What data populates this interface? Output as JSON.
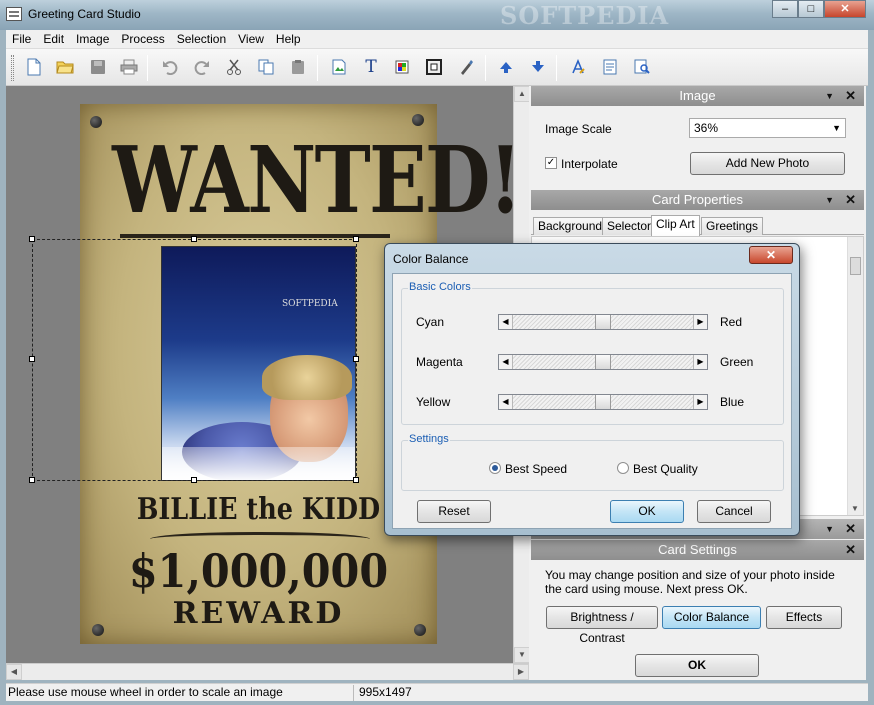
{
  "window": {
    "title": "Greeting Card Studio",
    "watermark": "SOFTPEDIA",
    "minimize": "–",
    "maximize": "□",
    "close": "✕"
  },
  "menu": [
    "File",
    "Edit",
    "Image",
    "Process",
    "Selection",
    "View",
    "Help"
  ],
  "toolbar": {
    "icons": [
      "new-file-icon",
      "open-folder-icon",
      "save-icon",
      "print-icon",
      "undo-icon",
      "redo-icon",
      "cut-icon",
      "copy-icon",
      "paste-icon",
      "insert-image-icon",
      "text-icon",
      "effects-icon",
      "frame-icon",
      "brush-icon",
      "move-up-icon",
      "move-down-icon",
      "font-icon",
      "document-icon",
      "find-icon"
    ],
    "text_glyph": "T"
  },
  "poster": {
    "headline": "WANTED!",
    "name": "BILLIE the KIDD",
    "amount": "$1,000,000",
    "reward": "REWARD",
    "photo_watermark": "SOFTPEDIA"
  },
  "image_panel": {
    "title": "Image",
    "scale_label": "Image Scale",
    "scale_value": "36%",
    "interpolate_label": "Interpolate",
    "interpolate_checked": true,
    "add_photo": "Add New Photo"
  },
  "card_properties": {
    "title": "Card Properties",
    "tabs": [
      "Background",
      "Selector",
      "Clip Art",
      "Greetings"
    ],
    "active_tab": "Clip Art"
  },
  "card_settings": {
    "title": "Card Settings",
    "hint": "You may change position and size of your photo inside the card using mouse. Next press OK.",
    "buttons": [
      "Brightness / Contrast",
      "Color Balance",
      "Effects"
    ],
    "selected": "Color Balance",
    "ok": "OK"
  },
  "dialog": {
    "title": "Color Balance",
    "close": "✕",
    "basic_colors_label": "Basic Colors",
    "rows": [
      {
        "left": "Cyan",
        "right": "Red",
        "value": 0
      },
      {
        "left": "Magenta",
        "right": "Green",
        "value": 0
      },
      {
        "left": "Yellow",
        "right": "Blue",
        "value": 0
      }
    ],
    "settings_label": "Settings",
    "radio_best_speed": "Best Speed",
    "radio_best_quality": "Best Quality",
    "selected_radio": "Best Speed",
    "reset": "Reset",
    "ok": "OK",
    "cancel": "Cancel"
  },
  "status": {
    "message": "Please use mouse wheel in order to scale an image",
    "dimensions": "995x1497"
  },
  "colors": {
    "accent": "#3c7fb1",
    "panel_header": "#9a9a9a",
    "dialog_group_label": "#1c5fb4"
  }
}
